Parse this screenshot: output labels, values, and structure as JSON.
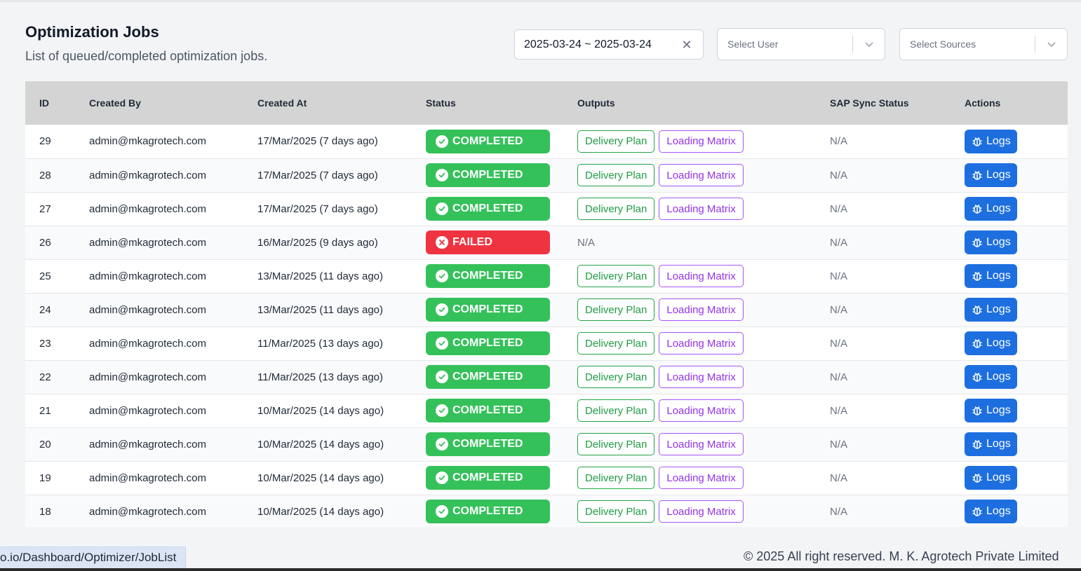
{
  "header": {
    "title": "Optimization Jobs",
    "subtitle": "List of queued/completed optimization jobs."
  },
  "filters": {
    "date_range": "2025-03-24 ~ 2025-03-24",
    "user_placeholder": "Select User",
    "sources_placeholder": "Select Sources"
  },
  "table": {
    "columns": [
      "ID",
      "Created By",
      "Created At",
      "Status",
      "Outputs",
      "SAP Sync Status",
      "Actions"
    ],
    "rows": [
      {
        "id": "29",
        "created_by": "admin@mkagrotech.com",
        "created_at": "17/Mar/2025 (7 days ago)",
        "status": "COMPLETED",
        "outputs": [
          "Delivery Plan",
          "Loading Matrix"
        ],
        "sap": "N/A",
        "action": "Logs"
      },
      {
        "id": "28",
        "created_by": "admin@mkagrotech.com",
        "created_at": "17/Mar/2025 (7 days ago)",
        "status": "COMPLETED",
        "outputs": [
          "Delivery Plan",
          "Loading Matrix"
        ],
        "sap": "N/A",
        "action": "Logs"
      },
      {
        "id": "27",
        "created_by": "admin@mkagrotech.com",
        "created_at": "17/Mar/2025 (7 days ago)",
        "status": "COMPLETED",
        "outputs": [
          "Delivery Plan",
          "Loading Matrix"
        ],
        "sap": "N/A",
        "action": "Logs"
      },
      {
        "id": "26",
        "created_by": "admin@mkagrotech.com",
        "created_at": "16/Mar/2025 (9 days ago)",
        "status": "FAILED",
        "outputs_na": "N/A",
        "sap": "N/A",
        "action": "Logs"
      },
      {
        "id": "25",
        "created_by": "admin@mkagrotech.com",
        "created_at": "13/Mar/2025 (11 days ago)",
        "status": "COMPLETED",
        "outputs": [
          "Delivery Plan",
          "Loading Matrix"
        ],
        "sap": "N/A",
        "action": "Logs"
      },
      {
        "id": "24",
        "created_by": "admin@mkagrotech.com",
        "created_at": "13/Mar/2025 (11 days ago)",
        "status": "COMPLETED",
        "outputs": [
          "Delivery Plan",
          "Loading Matrix"
        ],
        "sap": "N/A",
        "action": "Logs"
      },
      {
        "id": "23",
        "created_by": "admin@mkagrotech.com",
        "created_at": "11/Mar/2025 (13 days ago)",
        "status": "COMPLETED",
        "outputs": [
          "Delivery Plan",
          "Loading Matrix"
        ],
        "sap": "N/A",
        "action": "Logs"
      },
      {
        "id": "22",
        "created_by": "admin@mkagrotech.com",
        "created_at": "11/Mar/2025 (13 days ago)",
        "status": "COMPLETED",
        "outputs": [
          "Delivery Plan",
          "Loading Matrix"
        ],
        "sap": "N/A",
        "action": "Logs"
      },
      {
        "id": "21",
        "created_by": "admin@mkagrotech.com",
        "created_at": "10/Mar/2025 (14 days ago)",
        "status": "COMPLETED",
        "outputs": [
          "Delivery Plan",
          "Loading Matrix"
        ],
        "sap": "N/A",
        "action": "Logs"
      },
      {
        "id": "20",
        "created_by": "admin@mkagrotech.com",
        "created_at": "10/Mar/2025 (14 days ago)",
        "status": "COMPLETED",
        "outputs": [
          "Delivery Plan",
          "Loading Matrix"
        ],
        "sap": "N/A",
        "action": "Logs"
      },
      {
        "id": "19",
        "created_by": "admin@mkagrotech.com",
        "created_at": "10/Mar/2025 (14 days ago)",
        "status": "COMPLETED",
        "outputs": [
          "Delivery Plan",
          "Loading Matrix"
        ],
        "sap": "N/A",
        "action": "Logs"
      },
      {
        "id": "18",
        "created_by": "admin@mkagrotech.com",
        "created_at": "10/Mar/2025 (14 days ago)",
        "status": "COMPLETED",
        "outputs": [
          "Delivery Plan",
          "Loading Matrix"
        ],
        "sap": "N/A",
        "action": "Logs"
      }
    ]
  },
  "status_bar": {
    "url": "o.io/Dashboard/Optimizer/JobList"
  },
  "footer": {
    "copyright": "© 2025 All right reserved.  M. K. Agrotech Private Limited"
  },
  "colors": {
    "completed": "#34c15a",
    "failed": "#ef3340",
    "primary_button": "#1d6fe0",
    "delivery_plan_tag": "#1f9d44",
    "loading_matrix_tag": "#9333ea"
  },
  "icons": {
    "clear": "close-icon",
    "dropdown": "chevron-down-icon",
    "completed": "check-circle-icon",
    "failed": "x-circle-icon",
    "logs": "bug-icon"
  }
}
